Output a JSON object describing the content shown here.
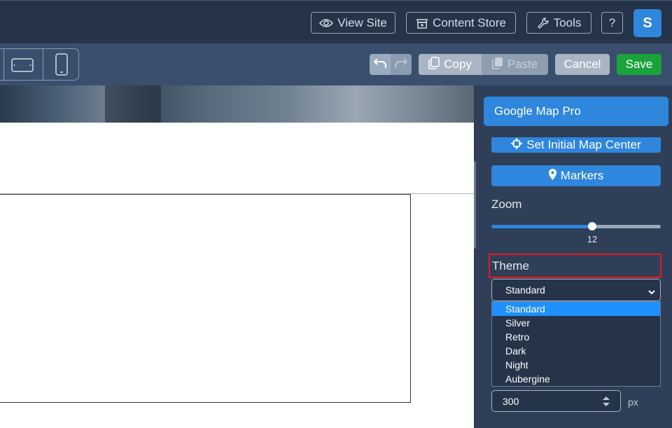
{
  "topbar": {
    "view_site": "View Site",
    "content_store": "Content Store",
    "tools": "Tools",
    "help": "?",
    "avatar_initial": "S"
  },
  "toolbar": {
    "copy": "Copy",
    "paste": "Paste",
    "cancel": "Cancel",
    "save": "Save"
  },
  "panel": {
    "title": "Google Map Pro",
    "set_center_label": "Set Initial Map Center",
    "markers_label": "Markers",
    "zoom": {
      "label": "Zoom",
      "value": 12,
      "value_text": "12",
      "fraction": 0.595
    },
    "theme": {
      "label": "Theme",
      "selected": "Standard",
      "options": [
        "Standard",
        "Silver",
        "Retro",
        "Dark",
        "Night",
        "Aubergine"
      ]
    },
    "height": {
      "value": "300",
      "unit": "px"
    }
  },
  "colors": {
    "topbar_bg": "#253449",
    "subbar_bg": "#3a4e6d",
    "panel_bg": "#2e3f57",
    "accent": "#2f86dd",
    "save": "#1aa33b",
    "highlight": "#e31b23",
    "option_selected": "#1e90ff"
  },
  "icons": {
    "view_site": "eye-icon",
    "content_store": "store-icon",
    "tools": "wrench-icon",
    "tablet_landscape": "tablet-landscape-icon",
    "mobile": "mobile-icon",
    "undo": "undo-icon",
    "redo": "redo-icon",
    "copy": "copy-icon",
    "paste": "paste-icon",
    "set_center": "crosshairs-icon",
    "markers": "map-marker-icon"
  }
}
